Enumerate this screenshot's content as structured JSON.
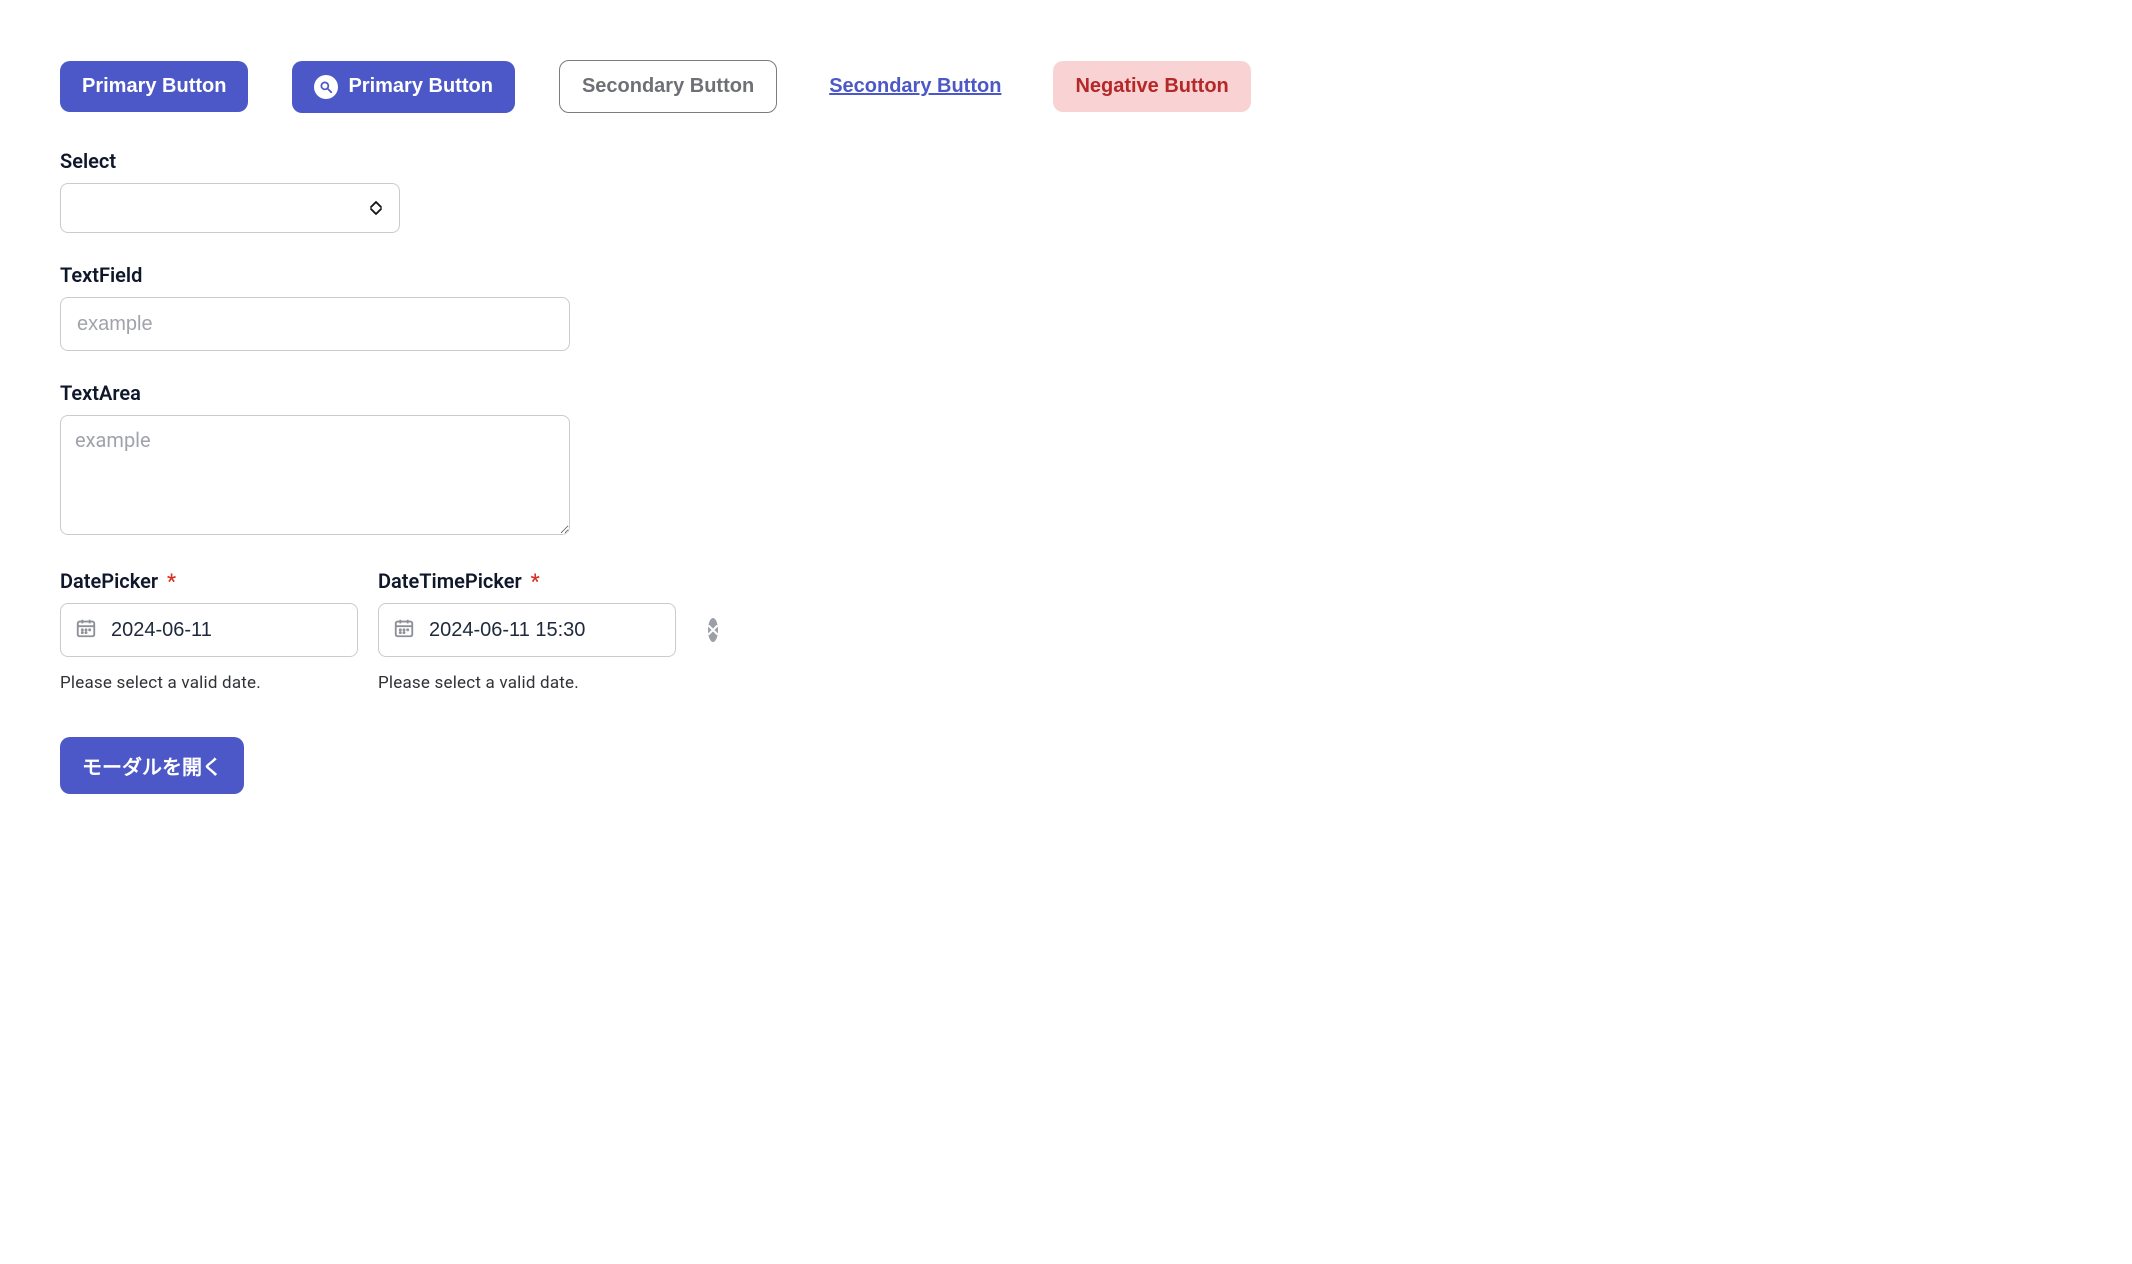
{
  "buttons": {
    "primary1": "Primary Button",
    "primary2": "Primary Button",
    "secondary_outline": "Secondary Button",
    "secondary_link": "Secondary Button",
    "negative": "Negative Button",
    "open_modal": "モーダルを開く"
  },
  "select": {
    "label": "Select",
    "value": ""
  },
  "textfield": {
    "label": "TextField",
    "placeholder": "example",
    "value": ""
  },
  "textarea": {
    "label": "TextArea",
    "placeholder": "example",
    "value": ""
  },
  "datepicker": {
    "label": "DatePicker",
    "required_mark": "*",
    "value": "2024-06-11",
    "help": "Please select a valid date."
  },
  "datetimepicker": {
    "label": "DateTimePicker",
    "required_mark": "*",
    "value": "2024-06-11 15:30",
    "help": "Please select a valid date."
  }
}
